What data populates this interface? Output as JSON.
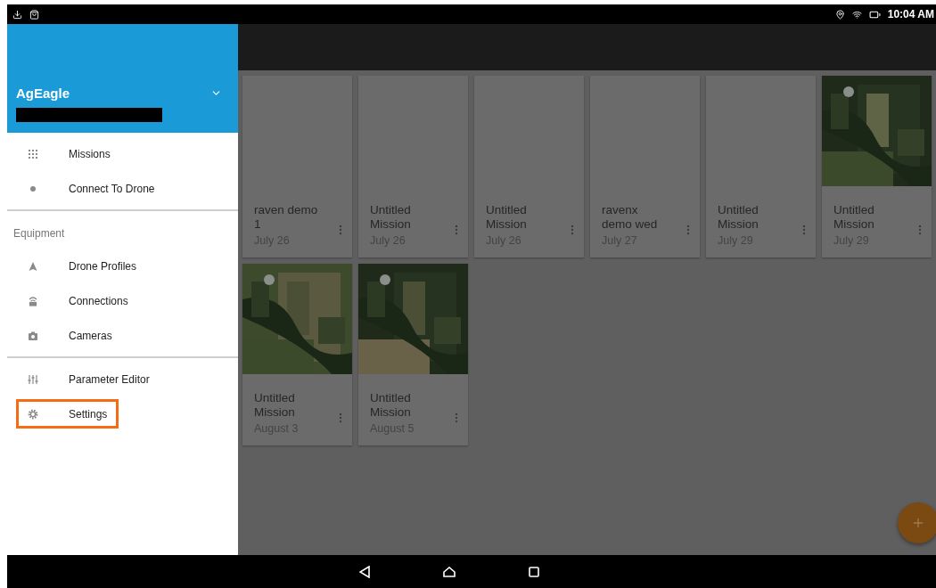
{
  "status_bar": {
    "time": "10:04 AM"
  },
  "drawer": {
    "title": "AgEagle",
    "sections": [
      {
        "items": [
          {
            "label": "Missions",
            "highlighted": false
          },
          {
            "label": "Connect To Drone",
            "highlighted": false
          }
        ]
      },
      {
        "label": "Equipment",
        "items": [
          {
            "label": "Drone Profiles",
            "highlighted": false
          },
          {
            "label": "Connections",
            "highlighted": false
          },
          {
            "label": "Cameras",
            "highlighted": false
          }
        ]
      },
      {
        "items": [
          {
            "label": "Parameter Editor",
            "highlighted": false
          },
          {
            "label": "Settings",
            "highlighted": true
          }
        ]
      }
    ]
  },
  "missions": [
    {
      "title": "raven demo 1",
      "date": "July 26",
      "kind": "blank"
    },
    {
      "title": "Untitled Mission",
      "date": "July 26",
      "kind": "blank"
    },
    {
      "title": "Untitled Mission",
      "date": "July 26",
      "kind": "blank"
    },
    {
      "title": "ravenx demo wed",
      "date": "July 27",
      "kind": "blank"
    },
    {
      "title": "Untitled Mission",
      "date": "July 29",
      "kind": "blank"
    },
    {
      "title": "Untitled Mission",
      "date": "July 29",
      "kind": "picture"
    },
    {
      "title": "Untitled Mission",
      "date": "August 3",
      "kind": "picture"
    },
    {
      "title": "Untitled Mission",
      "date": "August 5",
      "kind": "picture"
    }
  ]
}
